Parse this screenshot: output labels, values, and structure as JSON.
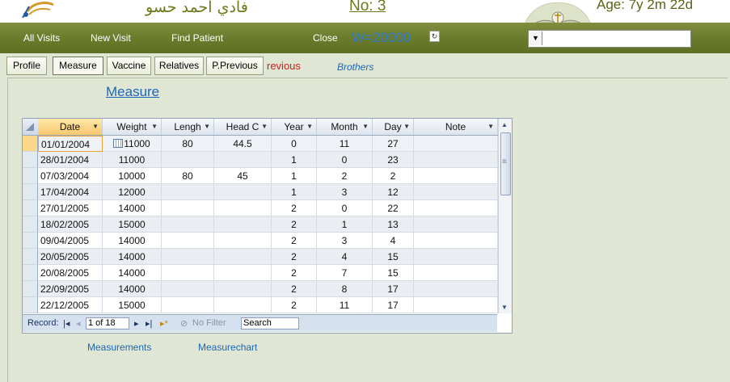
{
  "header": {
    "patient_name": "فادي أحمد حسو",
    "no_label": "No:  3",
    "age_label": "Age:  7y 2m 22d"
  },
  "nav": {
    "all_visits": "All Visits",
    "new_visit": "New Visit",
    "find_patient": "Find Patient",
    "close": "Close",
    "weight": "W=20000",
    "select_value": ""
  },
  "tabs": [
    {
      "label": "Profile"
    },
    {
      "label": "Measure"
    },
    {
      "label": "Vaccine"
    },
    {
      "label": "Relatives"
    },
    {
      "label": "P.Previous"
    }
  ],
  "previous_link": "revious",
  "brothers_link": "Brothers",
  "section_title": "Measure",
  "grid": {
    "columns": [
      "Date",
      "Weight",
      "Lengh",
      "Head C",
      "Year",
      "Month",
      "Day",
      "Note"
    ],
    "rows": [
      {
        "date": "01/01/2004",
        "weight": "11000",
        "length": "80",
        "head": "44.5",
        "year": "0",
        "month": "11",
        "day": "27",
        "note": ""
      },
      {
        "date": "28/01/2004",
        "weight": "11000",
        "length": "",
        "head": "",
        "year": "1",
        "month": "0",
        "day": "23",
        "note": ""
      },
      {
        "date": "07/03/2004",
        "weight": "10000",
        "length": "80",
        "head": "45",
        "year": "1",
        "month": "2",
        "day": "2",
        "note": ""
      },
      {
        "date": "17/04/2004",
        "weight": "12000",
        "length": "",
        "head": "",
        "year": "1",
        "month": "3",
        "day": "12",
        "note": ""
      },
      {
        "date": "27/01/2005",
        "weight": "14000",
        "length": "",
        "head": "",
        "year": "2",
        "month": "0",
        "day": "22",
        "note": ""
      },
      {
        "date": "18/02/2005",
        "weight": "15000",
        "length": "",
        "head": "",
        "year": "2",
        "month": "1",
        "day": "13",
        "note": ""
      },
      {
        "date": "09/04/2005",
        "weight": "14000",
        "length": "",
        "head": "",
        "year": "2",
        "month": "3",
        "day": "4",
        "note": ""
      },
      {
        "date": "20/05/2005",
        "weight": "14000",
        "length": "",
        "head": "",
        "year": "2",
        "month": "4",
        "day": "15",
        "note": ""
      },
      {
        "date": "20/08/2005",
        "weight": "14000",
        "length": "",
        "head": "",
        "year": "2",
        "month": "7",
        "day": "15",
        "note": ""
      },
      {
        "date": "22/09/2005",
        "weight": "14000",
        "length": "",
        "head": "",
        "year": "2",
        "month": "8",
        "day": "17",
        "note": ""
      },
      {
        "date": "22/12/2005",
        "weight": "15000",
        "length": "",
        "head": "",
        "year": "2",
        "month": "11",
        "day": "17",
        "note": ""
      }
    ],
    "record_label": "Record:",
    "record_value": "1 of 18",
    "no_filter": "No Filter",
    "search_label": "Search"
  },
  "footer": {
    "measurements": "Measurements",
    "measurechart": "Measurechart"
  },
  "colors": {
    "nav_bg": "#6a7a2b",
    "link_blue": "#1e67b8",
    "accent_red": "#cc2020"
  }
}
